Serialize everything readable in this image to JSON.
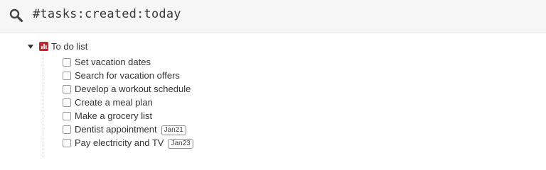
{
  "search": {
    "query": "#tasks:created:today"
  },
  "list": {
    "title": "To do list",
    "icon": "list-icon",
    "accent_color": "#d21f2c"
  },
  "tasks": [
    {
      "label": "Set vacation dates",
      "date": ""
    },
    {
      "label": "Search for vacation offers",
      "date": ""
    },
    {
      "label": "Develop a workout schedule",
      "date": ""
    },
    {
      "label": "Create a meal plan",
      "date": ""
    },
    {
      "label": "Make a grocery list",
      "date": ""
    },
    {
      "label": "Dentist appointment",
      "date": "Jan21"
    },
    {
      "label": "Pay electricity and TV",
      "date": "Jan23"
    }
  ]
}
